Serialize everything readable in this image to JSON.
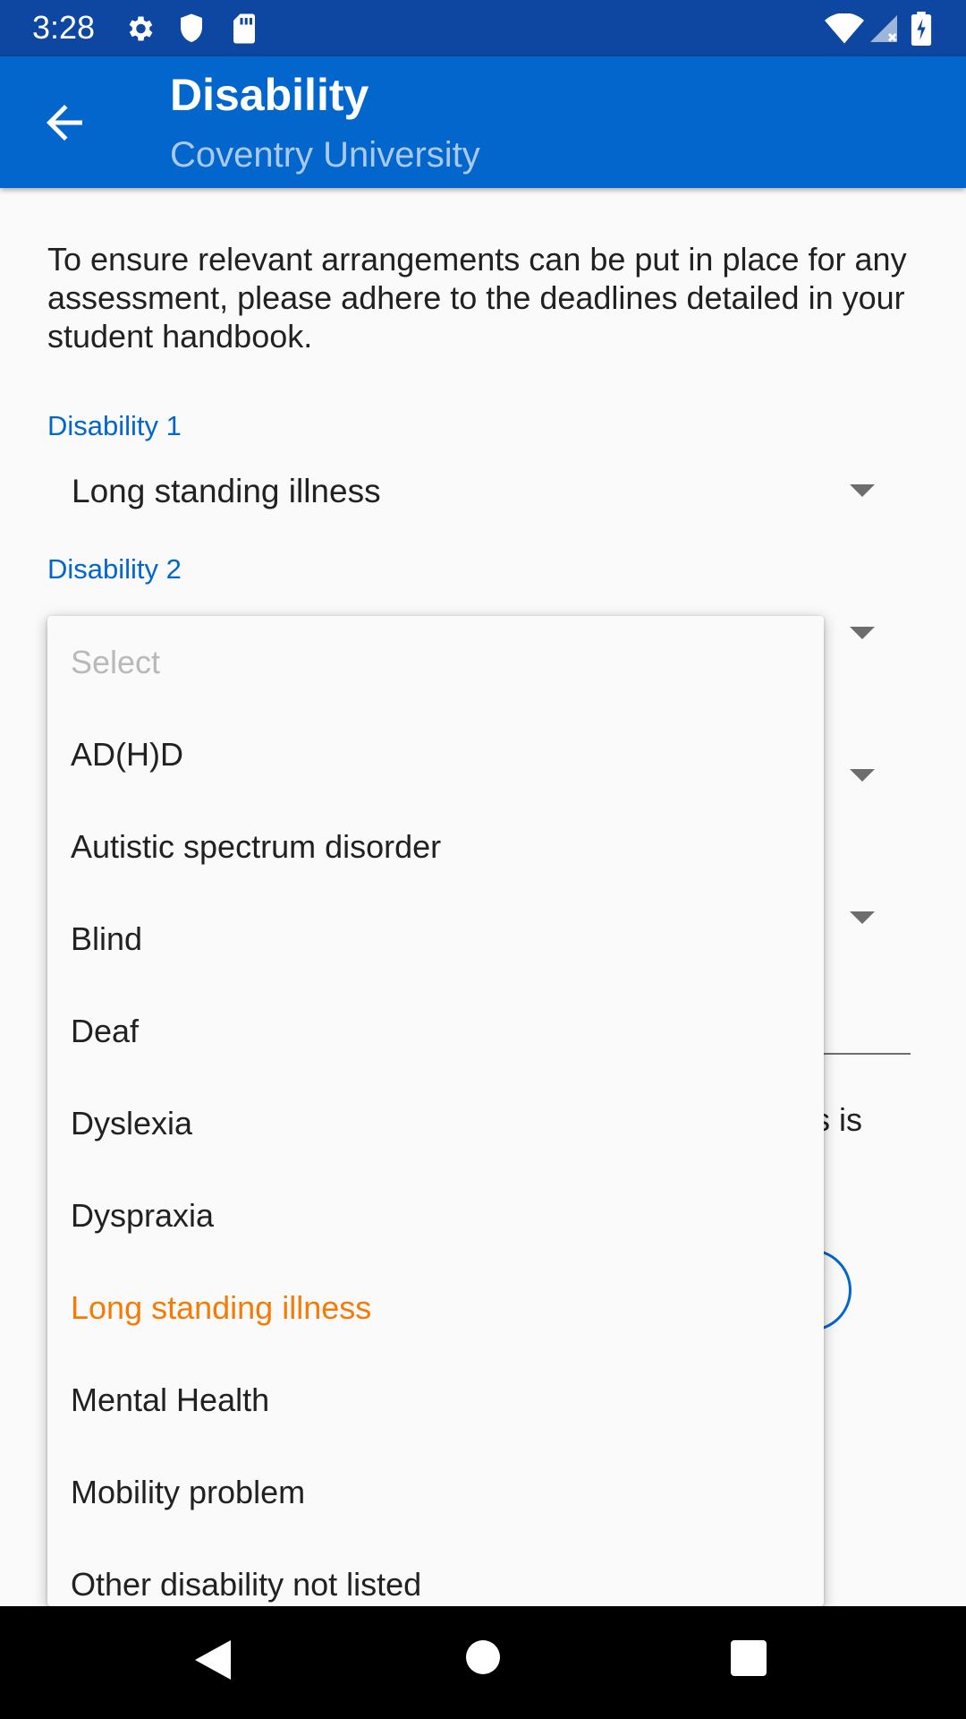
{
  "status_bar": {
    "time": "3:28",
    "left_icons": [
      "gear-icon",
      "shield-icon",
      "sd-card-icon"
    ],
    "right_icons": [
      "wifi-icon",
      "signal-icon",
      "battery-charging-icon"
    ]
  },
  "app_bar": {
    "title": "Disability",
    "subtitle": "Coventry University"
  },
  "intro_text": "To ensure relevant arrangements can be put in place for any assessment, please adhere to the deadlines detailed in your student handbook.",
  "fields": {
    "disability1": {
      "label": "Disability 1",
      "value": "Long standing illness"
    },
    "disability2": {
      "label": "Disability 2"
    }
  },
  "background_fragment": "s is",
  "dropdown": {
    "placeholder": "Select",
    "selected": "Long standing illness",
    "options": [
      "AD(H)D",
      "Autistic spectrum disorder",
      "Blind",
      "Deaf",
      "Dyslexia",
      "Dyspraxia",
      "Long standing illness",
      "Mental Health",
      "Mobility problem",
      "Other disability not listed"
    ]
  },
  "colors": {
    "status_bar": "#0d47a1",
    "app_bar": "#0266cc",
    "accent_label": "#0266cc",
    "selected_option": "#f47c06"
  }
}
